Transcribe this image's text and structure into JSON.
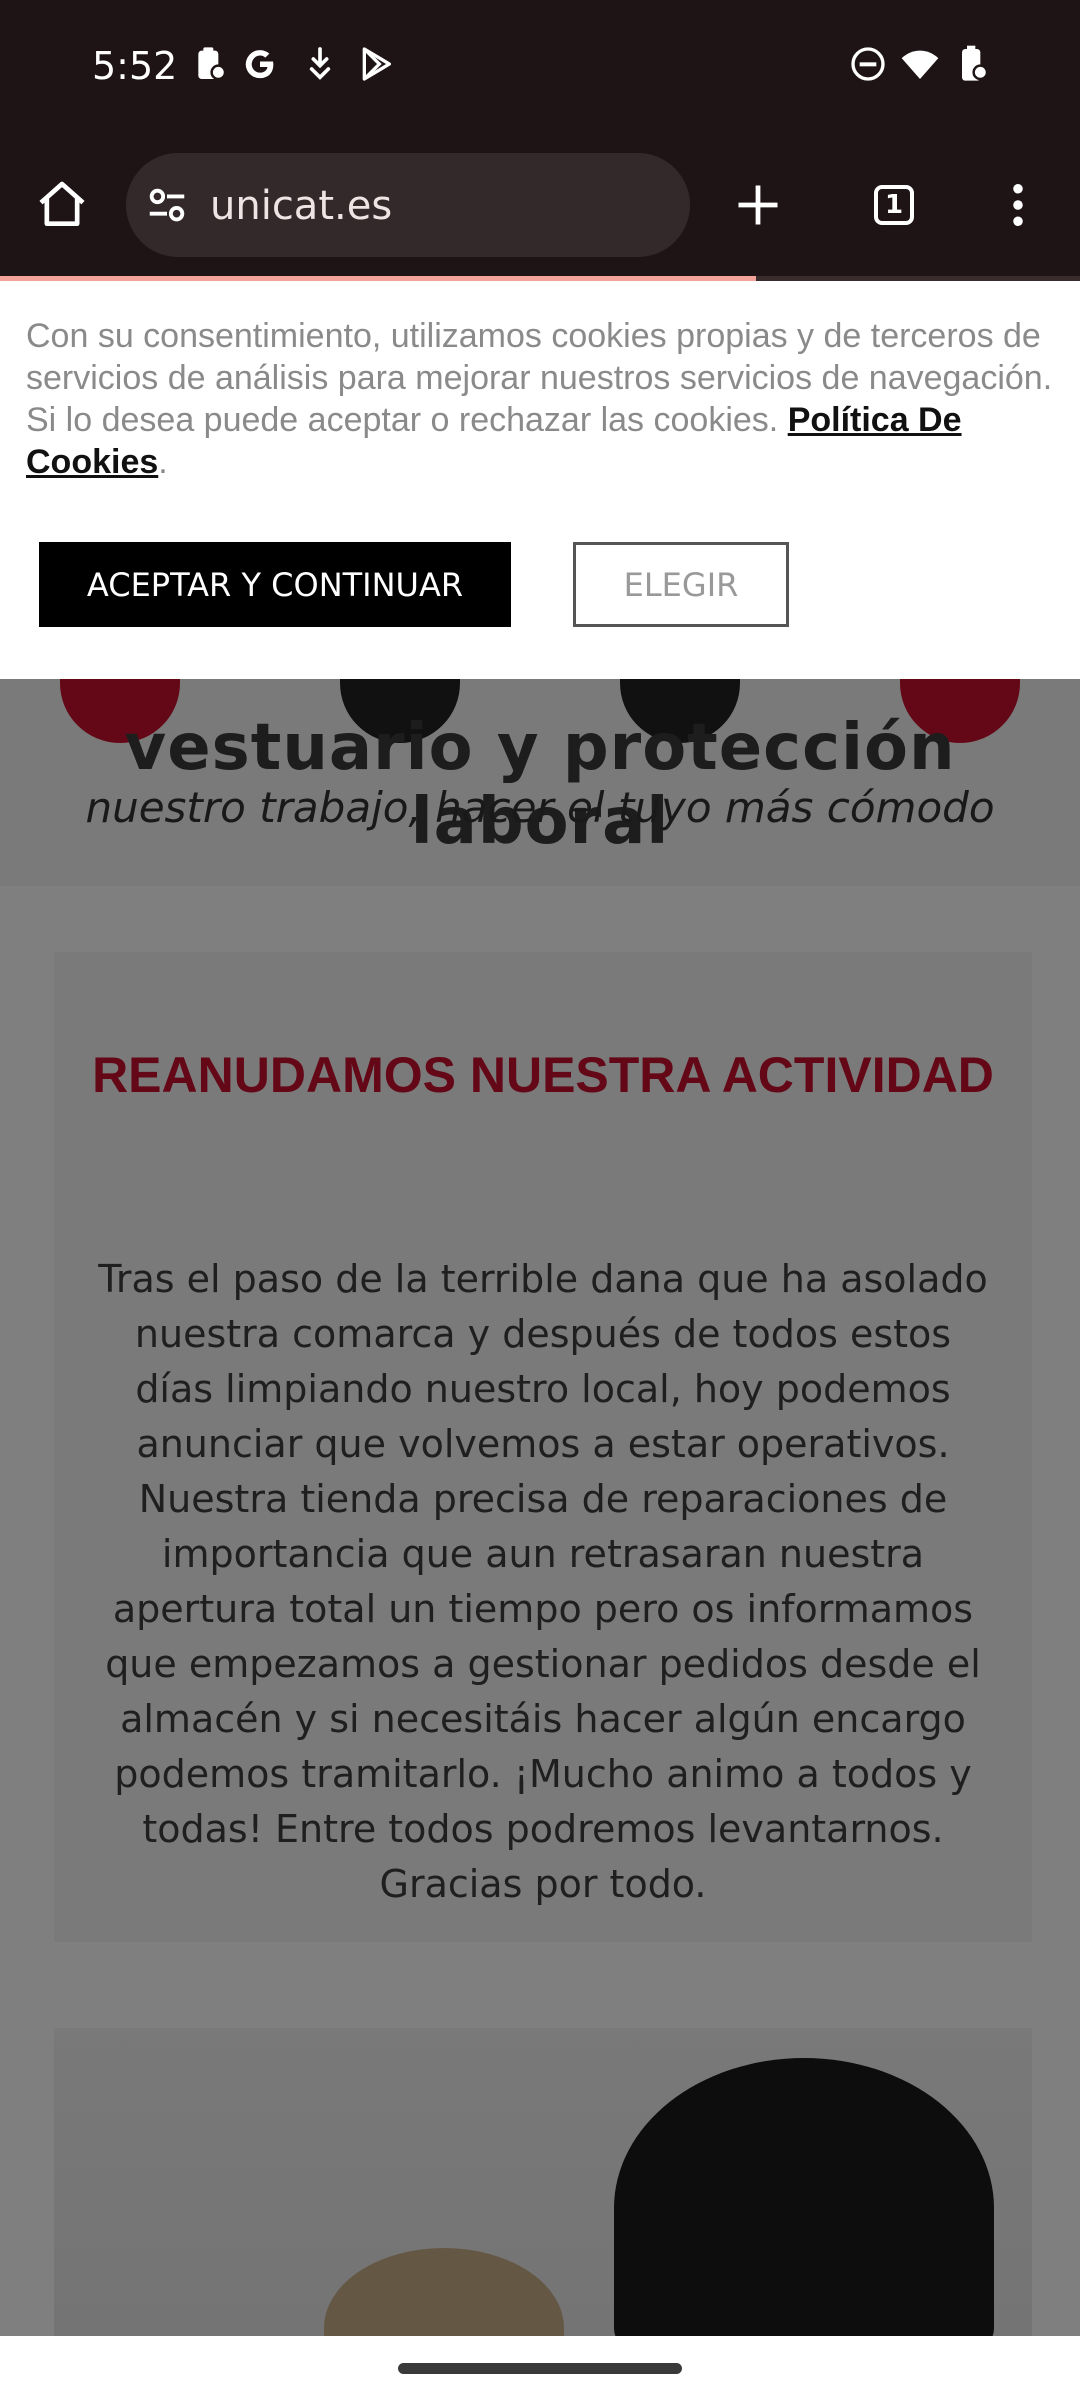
{
  "status_bar": {
    "time": "5:52",
    "left_icons": [
      "clipboard-icon",
      "google-icon",
      "download-icon",
      "play-store-icon"
    ],
    "right_icons": [
      "dnd-icon",
      "wifi-icon",
      "battery-icon"
    ]
  },
  "browser": {
    "url": "unicat.es",
    "tab_count": "1",
    "load_progress_fraction": 0.7,
    "icons": [
      "home-icon",
      "site-settings-icon",
      "new-tab-icon",
      "tab-switcher-icon",
      "menu-icon"
    ]
  },
  "cookie_banner": {
    "text": "Con su consentimiento, utilizamos cookies propias y de terceros de servicios de análisis para mejorar nuestros servicios de navegación. Si lo desea puede aceptar o rechazar las cookies. ",
    "policy_link": "Política De Cookies",
    "trailing": ".",
    "accept_label": "ACEPTAR Y CONTINUAR",
    "choose_label": "ELEGIR"
  },
  "logo": {
    "line1": "vestuario y protección laboral",
    "line2": "nuestro trabajo, hacer el tuyo más cómodo"
  },
  "news": {
    "title": "REANUDAMOS NUESTRA ACTIVIDAD",
    "body": "Tras el paso de la terrible dana que ha asolado nuestra comarca y después de todos estos días limpiando nuestro local, hoy podemos anunciar que volvemos a estar operativos. Nuestra tienda precisa de reparaciones de importancia que aun retrasaran nuestra apertura total un tiempo pero os informamos que empezamos a gestionar pedidos desde el almacén y si necesitáis hacer algún encargo podemos tramitarlo. ¡Mucho animo a todos y todas! Entre todos podremos levantarnos. Gracias por todo."
  },
  "colors": {
    "brand_red": "#c8102e",
    "browser_chrome": "#1e1415",
    "progress": "#f3a39a"
  }
}
